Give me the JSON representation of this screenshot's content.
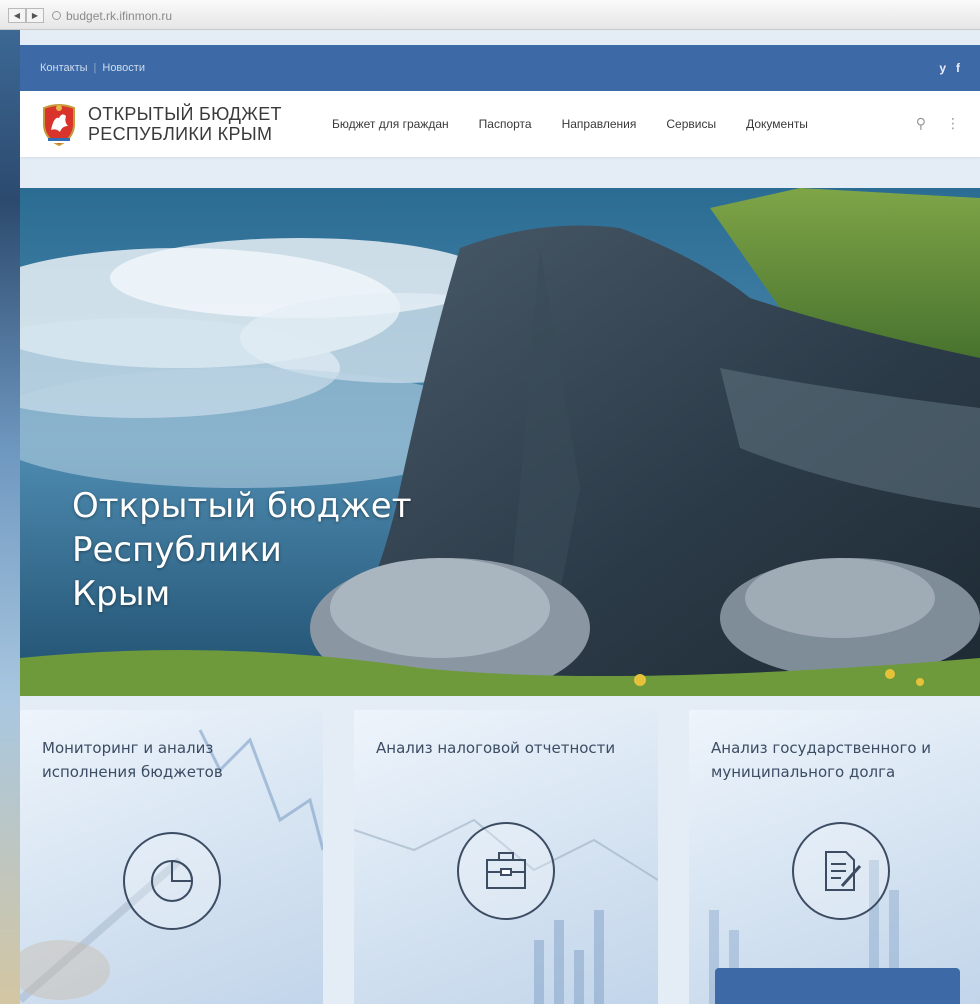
{
  "browser": {
    "back_glyph": "◀",
    "forward_glyph": "▶",
    "url": "budget.rk.ifinmon.ru"
  },
  "topbar": {
    "links": [
      "Контакты",
      "Новости"
    ],
    "separator": "|",
    "social": [
      "twitter-icon",
      "facebook-icon"
    ],
    "twitter_glyph": "y",
    "facebook_glyph": "f"
  },
  "header": {
    "logo_line1": "ОТКРЫТЫЙ БЮДЖЕТ",
    "logo_line2": "РЕСПУБЛИКИ КРЫМ",
    "menu": [
      "Бюджет для граждан",
      "Паспорта",
      "Направления",
      "Сервисы",
      "Документы"
    ],
    "search_glyph": "⚲",
    "more_glyph": "⋮"
  },
  "hero": {
    "title_line1": "Открытый бюджет",
    "title_line2": "Республики",
    "title_line3": "Крым"
  },
  "cards": [
    {
      "title": "Мониторинг и анализ исполнения бюджетов",
      "icon": "pie-chart-icon"
    },
    {
      "title": "Анализ налоговой отчетности",
      "icon": "briefcase-icon"
    },
    {
      "title": "Анализ государственного и муниципального долга",
      "icon": "document-pen-icon"
    }
  ],
  "colors": {
    "brand_blue": "#3d6aa7",
    "text_dark": "#3a3a3a",
    "card_text": "#3b4c63"
  }
}
